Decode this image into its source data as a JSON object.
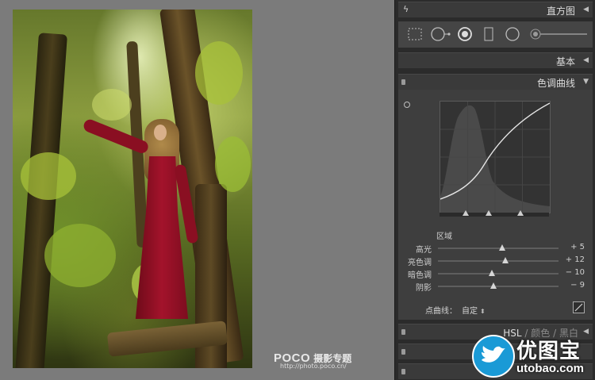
{
  "watermark": {
    "brand": "POCO",
    "brand_cn": "摄影专题",
    "url": "http://photo.poco.cn/"
  },
  "panels": {
    "histogram": "直方图",
    "basic": "基本",
    "tone_curve": "色调曲线",
    "hsl_tabs": [
      "HSL",
      "/",
      "颜色",
      "/",
      "黑白"
    ]
  },
  "tone_curve": {
    "region_title": "区域",
    "sliders": [
      {
        "label": "高光",
        "value": "+ 5",
        "position": 0.53
      },
      {
        "label": "亮色调",
        "value": "+ 12",
        "position": 0.56
      },
      {
        "label": "暗色调",
        "value": "− 10",
        "position": 0.45
      },
      {
        "label": "阴影",
        "value": "− 9",
        "position": 0.46
      }
    ],
    "point_curve_label": "点曲线：",
    "point_curve_value": "自定",
    "split_points": [
      0.24,
      0.45,
      0.74
    ]
  },
  "logo": {
    "cn": "优图宝",
    "url": "utobao.com"
  },
  "colors": {
    "panel_bg": "#2b2b2b",
    "header_bg": "#3a3a3a",
    "accent_blue": "#1a9ad6"
  },
  "icons": [
    "lightning-icon",
    "grid-icon",
    "crop-overlay-icon",
    "spot-removal-icon",
    "red-eye-icon",
    "graduated-filter-icon",
    "radial-filter-icon",
    "adjustment-brush-icon"
  ]
}
